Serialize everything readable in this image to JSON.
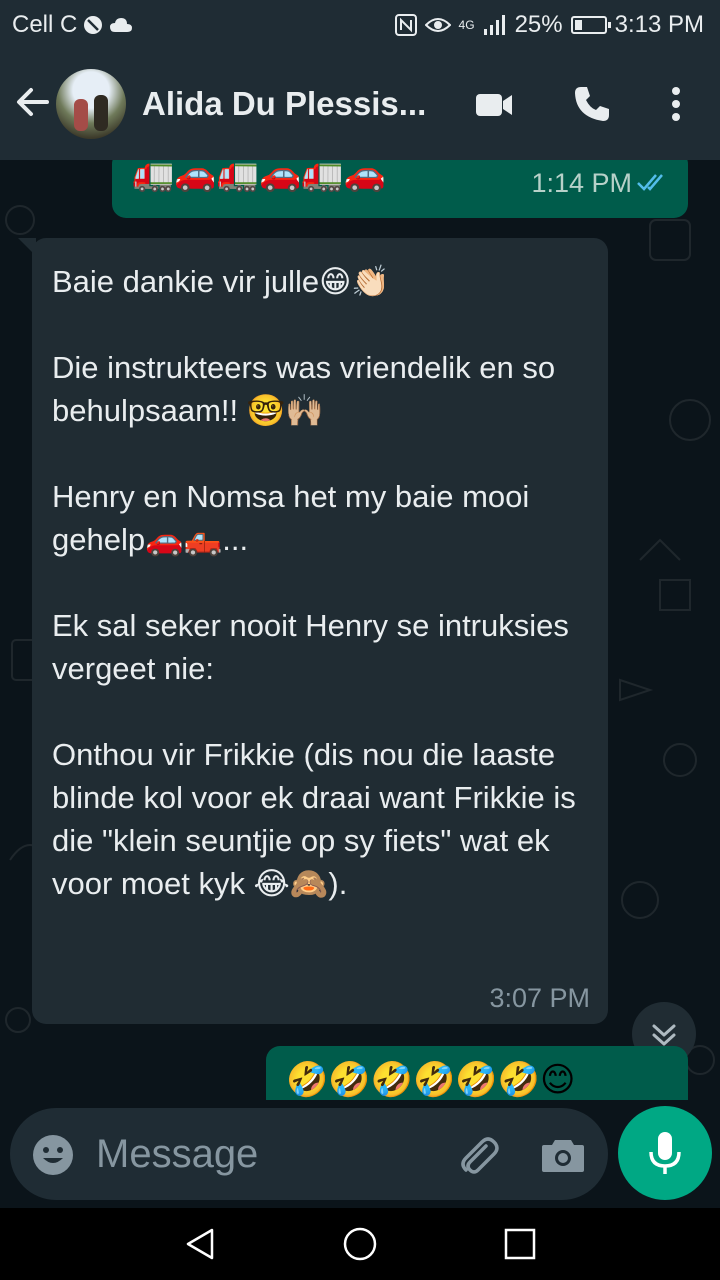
{
  "status_bar": {
    "carrier": "Cell C",
    "network": "4G",
    "battery": "25%",
    "battery_level": 0.25,
    "time": "3:13 PM"
  },
  "header": {
    "contact_name": "Alida Du Plessis...",
    "icons": [
      "back-arrow-icon",
      "video-call-icon",
      "voice-call-icon",
      "more-options-icon"
    ]
  },
  "messages": [
    {
      "direction": "outgoing",
      "emojis": "🚛🚗🚛🚗🚛🚗",
      "time": "1:14 PM",
      "status": "read"
    },
    {
      "direction": "incoming",
      "text": "Baie dankie vir julle😁👏🏻\n\nDie instrukteers was vriendelik en so behulpsaam!! 🤓🙌🏼\n\nHenry en Nomsa het my baie mooi gehelp🚗🛻...\n\nEk sal seker nooit Henry se intruksies vergeet nie:\n\nOnthou vir Frikkie (dis nou die laaste blinde kol voor ek draai want Frikkie is die \"klein seuntjie op sy fiets\" wat ek voor moet kyk 😂🙈).",
      "time": "3:07 PM"
    },
    {
      "direction": "outgoing",
      "emojis": "🤣🤣🤣🤣🤣🤣😊"
    }
  ],
  "input": {
    "placeholder": "Message"
  },
  "colors": {
    "background": "#0b141a",
    "header": "#1f2c34",
    "incoming_bubble": "#202c33",
    "outgoing_bubble": "#005c4b",
    "accent": "#00a884",
    "read_ticks": "#53bdeb"
  }
}
